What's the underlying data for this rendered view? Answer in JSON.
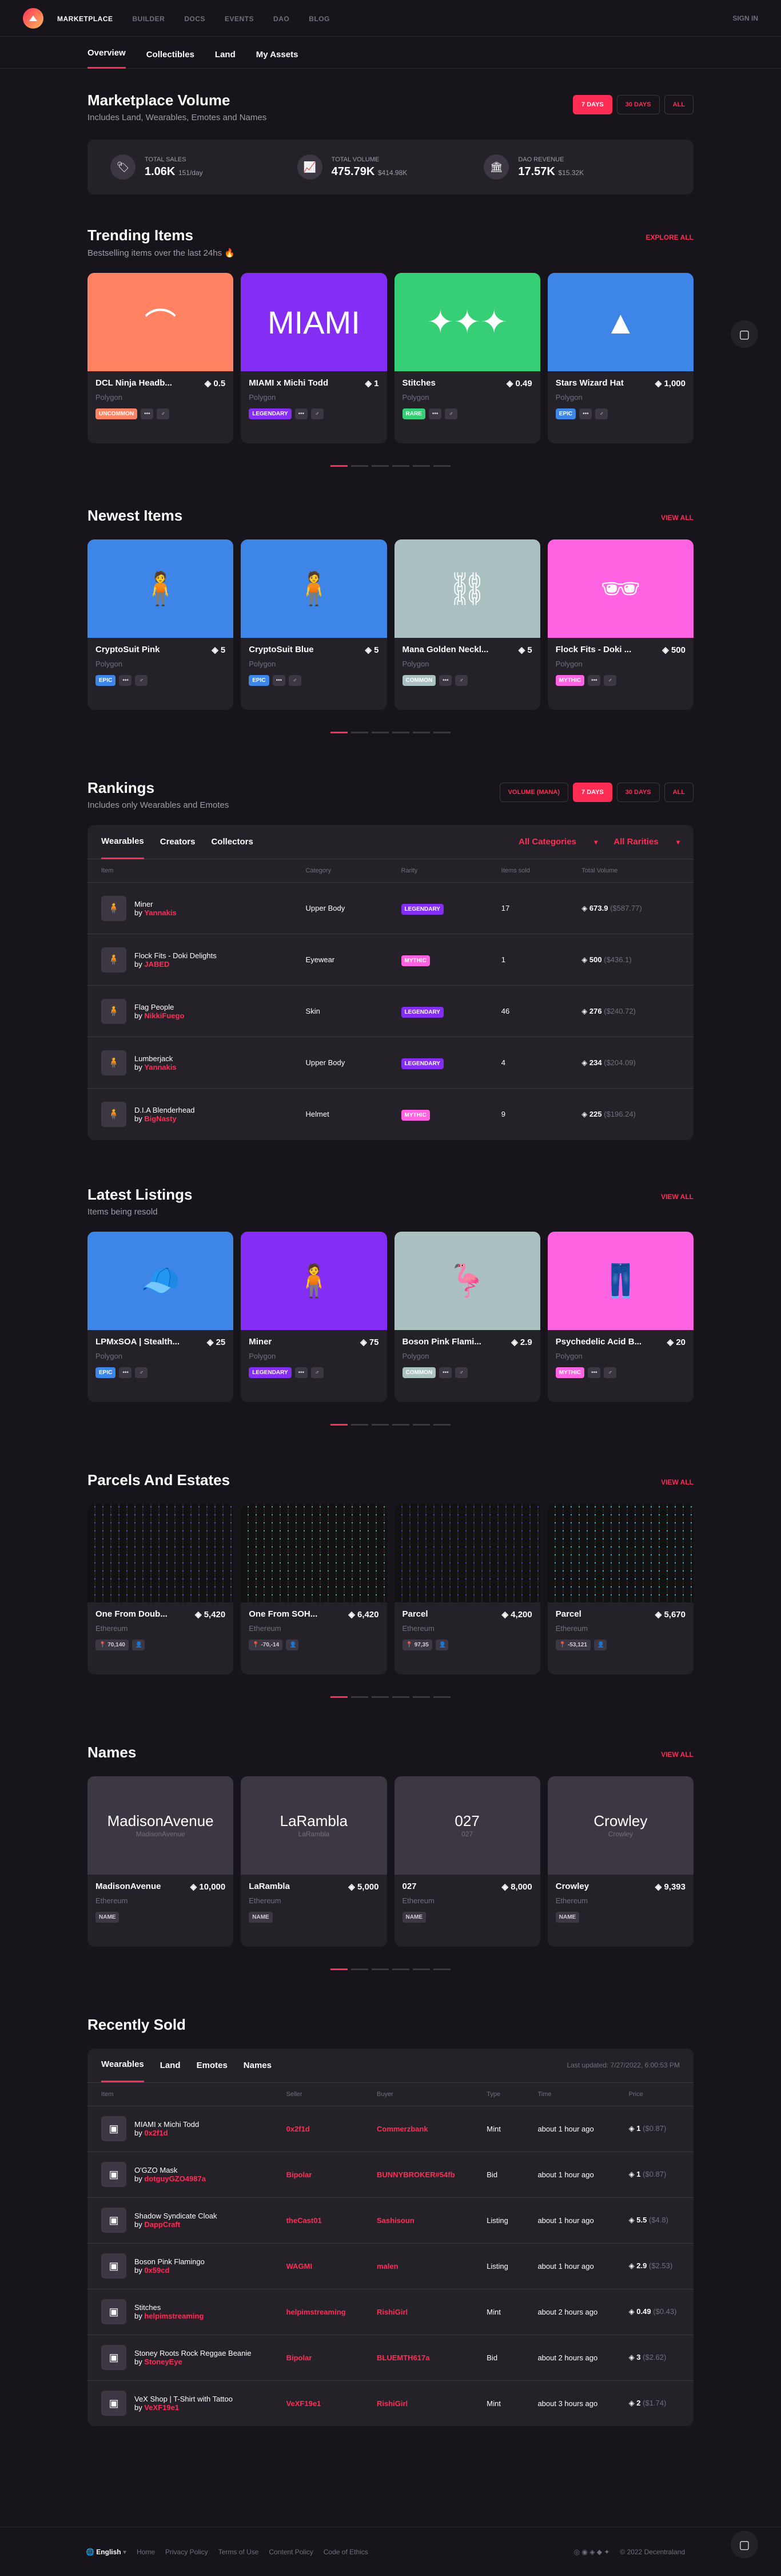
{
  "nav": {
    "items": [
      "Marketplace",
      "Builder",
      "Docs",
      "Events",
      "DAO",
      "Blog"
    ],
    "signin": "Sign In"
  },
  "subnav": [
    "Overview",
    "Collectibles",
    "Land",
    "My Assets"
  ],
  "volume": {
    "title": "Marketplace Volume",
    "subtitle": "Includes Land, Wearables, Emotes and Names",
    "ranges": [
      "7 Days",
      "30 Days",
      "All"
    ],
    "stats": [
      {
        "label": "Total Sales",
        "value": "1.06K",
        "extra": "151/day"
      },
      {
        "label": "Total Volume",
        "value": "475.79K",
        "extra": "$414.98K"
      },
      {
        "label": "DAO Revenue",
        "value": "17.57K",
        "extra": "$15.32K"
      }
    ]
  },
  "trending": {
    "title": "Trending Items",
    "subtitle": "Bestselling items over the last 24hs 🔥",
    "cta": "Explore All",
    "items": [
      {
        "name": "DCL Ninja Headb...",
        "price": "0.5",
        "chain": "Polygon",
        "rarity": "Uncommon",
        "rc": "#ff8362",
        "bg": "#ff8362",
        "ic": "⌒"
      },
      {
        "name": "MIAMI x Michi Todd",
        "price": "1",
        "chain": "Polygon",
        "rarity": "Legendary",
        "rc": "#842df4",
        "bg": "#842df4",
        "ic": "MIAMI"
      },
      {
        "name": "Stitches",
        "price": "0.49",
        "chain": "Polygon",
        "rarity": "Rare",
        "rc": "#36cf75",
        "bg": "#36cf75",
        "ic": "✦✦✦"
      },
      {
        "name": "Stars Wizard Hat",
        "price": "1,000",
        "chain": "Polygon",
        "rarity": "Epic",
        "rc": "#3d85e6",
        "bg": "#3d85e6",
        "ic": "▲"
      }
    ]
  },
  "newest": {
    "title": "Newest Items",
    "cta": "View All",
    "items": [
      {
        "name": "CryptoSuit Pink",
        "price": "5",
        "chain": "Polygon",
        "rarity": "Epic",
        "rc": "#3d85e6",
        "bg": "#3d85e6",
        "ic": "🧍"
      },
      {
        "name": "CryptoSuit Blue",
        "price": "5",
        "chain": "Polygon",
        "rarity": "Epic",
        "rc": "#3d85e6",
        "bg": "#3d85e6",
        "ic": "🧍"
      },
      {
        "name": "Mana Golden Neckl...",
        "price": "5",
        "chain": "Polygon",
        "rarity": "Common",
        "rc": "#abc1c1",
        "bg": "#abc1c1",
        "ic": "⛓"
      },
      {
        "name": "Flock Fits - Doki ...",
        "price": "500",
        "chain": "Polygon",
        "rarity": "Mythic",
        "rc": "#ff63e1",
        "bg": "#ff63e1",
        "ic": "🕶"
      }
    ]
  },
  "rankings": {
    "title": "Rankings",
    "subtitle": "Includes only Wearables and Emotes",
    "filter": "Volume (MANA)",
    "ranges": [
      "7 Days",
      "30 Days",
      "All"
    ],
    "tabs": [
      "Wearables",
      "Creators",
      "Collectors"
    ],
    "cat": "All Categories",
    "rar": "All Rarities",
    "cols": [
      "Item",
      "Category",
      "Rarity",
      "Items sold",
      "Total Volume"
    ],
    "rows": [
      {
        "name": "Miner",
        "by": "Yannakis",
        "cat": "Upper Body",
        "rar": "Legendary",
        "rc": "#842df4",
        "sold": "17",
        "vol": "673.9",
        "usd": "($587.77)"
      },
      {
        "name": "Flock Fits - Doki Delights",
        "by": "JABED",
        "cat": "Eyewear",
        "rar": "Mythic",
        "rc": "#ff63e1",
        "sold": "1",
        "vol": "500",
        "usd": "($436.1)"
      },
      {
        "name": "Flag People",
        "by": "NikkiFuego",
        "cat": "Skin",
        "rar": "Legendary",
        "rc": "#842df4",
        "sold": "46",
        "vol": "276",
        "usd": "($240.72)"
      },
      {
        "name": "Lumberjack",
        "by": "Yannakis",
        "cat": "Upper Body",
        "rar": "Legendary",
        "rc": "#842df4",
        "sold": "4",
        "vol": "234",
        "usd": "($204.09)"
      },
      {
        "name": "D.I.A Blenderhead",
        "by": "BigNasty",
        "cat": "Helmet",
        "rar": "Mythic",
        "rc": "#ff63e1",
        "sold": "9",
        "vol": "225",
        "usd": "($196.24)"
      }
    ]
  },
  "listings": {
    "title": "Latest Listings",
    "subtitle": "Items being resold",
    "cta": "View All",
    "items": [
      {
        "name": "LPMxSOA | Stealth...",
        "price": "25",
        "chain": "Polygon",
        "rarity": "Epic",
        "rc": "#3d85e6",
        "bg": "#3d85e6",
        "ic": "🧢"
      },
      {
        "name": "Miner",
        "price": "75",
        "chain": "Polygon",
        "rarity": "Legendary",
        "rc": "#842df4",
        "bg": "#842df4",
        "ic": "🧍"
      },
      {
        "name": "Boson Pink Flami...",
        "price": "2.9",
        "chain": "Polygon",
        "rarity": "Common",
        "rc": "#abc1c1",
        "bg": "#abc1c1",
        "ic": "🦩"
      },
      {
        "name": "Psychedelic Acid B...",
        "price": "20",
        "chain": "Polygon",
        "rarity": "Mythic",
        "rc": "#ff63e1",
        "bg": "#ff63e1",
        "ic": "👖"
      }
    ]
  },
  "parcels": {
    "title": "Parcels And Estates",
    "cta": "View All",
    "items": [
      {
        "name": "One From Doub...",
        "price": "5,420",
        "chain": "Ethereum",
        "coord": "70,140",
        "bg": "#5c4fe0"
      },
      {
        "name": "One From SOH...",
        "price": "6,420",
        "chain": "Ethereum",
        "coord": "-70,-14",
        "bg": "#57b884"
      },
      {
        "name": "Parcel",
        "price": "4,200",
        "chain": "Ethereum",
        "coord": "97,35",
        "bg": "#4c3fd9"
      },
      {
        "name": "Parcel",
        "price": "5,670",
        "chain": "Ethereum",
        "coord": "-53,121",
        "bg": "#2cc6f0"
      }
    ]
  },
  "names": {
    "title": "Names",
    "cta": "View All",
    "items": [
      {
        "name": "MadisonAvenue",
        "price": "10,000",
        "chain": "Ethereum",
        "sub": "MadisonAvenue"
      },
      {
        "name": "LaRambla",
        "price": "5,000",
        "chain": "Ethereum",
        "sub": "LaRambla"
      },
      {
        "name": "027",
        "price": "8,000",
        "chain": "Ethereum",
        "sub": "027"
      },
      {
        "name": "Crowley",
        "price": "9,393",
        "chain": "Ethereum",
        "sub": "Crowley"
      }
    ],
    "badge": "Name"
  },
  "sold": {
    "title": "Recently Sold",
    "tabs": [
      "Wearables",
      "Land",
      "Emotes",
      "Names"
    ],
    "updated": "Last updated: 7/27/2022, 6:00:53 PM",
    "cols": [
      "Item",
      "Seller",
      "Buyer",
      "Type",
      "Time",
      "Price"
    ],
    "rows": [
      {
        "name": "MIAMI x Michi Todd",
        "by": "0x2f1d",
        "seller": "0x2f1d",
        "buyer": "Commerzbank",
        "type": "Mint",
        "time": "about 1 hour ago",
        "price": "1",
        "usd": "($0.87)"
      },
      {
        "name": "O'GZO Mask",
        "by": "dotguyGZO4987a",
        "seller": "Bipolar",
        "buyer": "BUNNYBROKER#54fb",
        "type": "Bid",
        "time": "about 1 hour ago",
        "price": "1",
        "usd": "($0.87)"
      },
      {
        "name": "Shadow Syndicate Cloak",
        "by": "DappCraft",
        "seller": "theCast01",
        "buyer": "Sashisoun",
        "type": "Listing",
        "time": "about 1 hour ago",
        "price": "5.5",
        "usd": "($4.8)"
      },
      {
        "name": "Boson Pink Flamingo",
        "by": "0x59cd",
        "seller": "WAGMI",
        "buyer": "malen",
        "type": "Listing",
        "time": "about 1 hour ago",
        "price": "2.9",
        "usd": "($2.53)"
      },
      {
        "name": "Stitches",
        "by": "helpimstreaming",
        "seller": "helpimstreaming",
        "buyer": "RishiGirl",
        "type": "Mint",
        "time": "about 2 hours ago",
        "price": "0.49",
        "usd": "($0.43)"
      },
      {
        "name": "Stoney Roots Rock Reggae Beanie",
        "by": "StoneyEye",
        "seller": "Bipolar",
        "buyer": "BLUEMTH617a",
        "type": "Bid",
        "time": "about 2 hours ago",
        "price": "3",
        "usd": "($2.62)"
      },
      {
        "name": "VeX Shop | T-Shirt with Tattoo",
        "by": "VeXF19e1",
        "seller": "VeXF19e1",
        "buyer": "RishiGirl",
        "type": "Mint",
        "time": "about 3 hours ago",
        "price": "2",
        "usd": "($1.74)"
      }
    ]
  },
  "footer": {
    "lang": "English",
    "links": [
      "Home",
      "Privacy Policy",
      "Terms of Use",
      "Content Policy",
      "Code of Ethics"
    ],
    "copy": "© 2022 Decentraland"
  }
}
